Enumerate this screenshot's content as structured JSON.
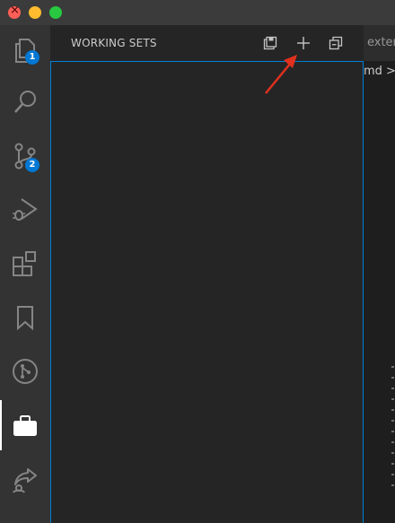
{
  "window": {
    "traffic_lights": [
      "close",
      "minimize",
      "maximize"
    ],
    "colors": {
      "close": "#fe5f57",
      "minimize": "#febc2e",
      "maximize": "#28c840"
    }
  },
  "activity_bar": {
    "items": [
      {
        "name": "explorer",
        "icon": "files-icon",
        "badge": "1"
      },
      {
        "name": "search",
        "icon": "search-icon"
      },
      {
        "name": "source-control",
        "icon": "source-control-icon",
        "badge": "2"
      },
      {
        "name": "run-debug",
        "icon": "run-debug-icon"
      },
      {
        "name": "extensions",
        "icon": "extensions-icon"
      },
      {
        "name": "bookmarks",
        "icon": "bookmark-icon"
      },
      {
        "name": "git-graph",
        "icon": "git-graph-icon"
      },
      {
        "name": "working-sets",
        "icon": "briefcase-icon",
        "active": true
      },
      {
        "name": "live-share",
        "icon": "live-share-icon"
      }
    ],
    "badge_color": "#0078d4"
  },
  "sidebar": {
    "title": "WORKING SETS",
    "actions": [
      {
        "name": "save-working-set",
        "icon": "save-all-icon"
      },
      {
        "name": "new-working-set",
        "icon": "plus-icon"
      },
      {
        "name": "collapse-all",
        "icon": "collapse-all-icon"
      }
    ],
    "focus_border_color": "#007fd4"
  },
  "editor": {
    "tab_label": "extens",
    "breadcrumb": "md >"
  },
  "annotation": {
    "arrow_color": "#e0301e",
    "points_to": "new-working-set-button"
  }
}
